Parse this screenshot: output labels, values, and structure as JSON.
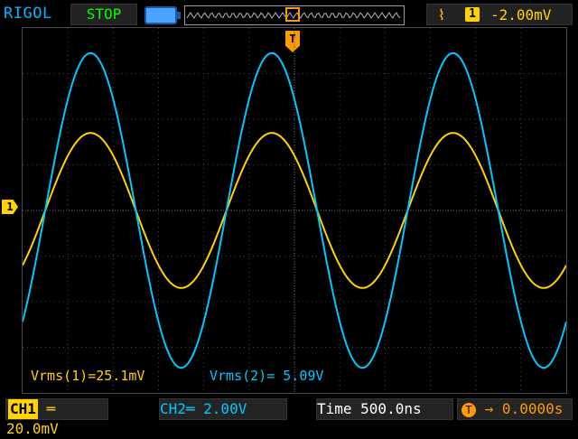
{
  "header": {
    "brand": "RIGOL",
    "run_state": "STOP",
    "trigger_edge_icon": "rising-edge-icon",
    "trigger_channel": "1",
    "trigger_level": "-2.00mV"
  },
  "markers": {
    "trigger_position": "T",
    "channel1": "1"
  },
  "measurements": {
    "ch1": "Vrms(1)=25.1mV",
    "ch2": "Vrms(2)= 5.09V"
  },
  "footer": {
    "ch1_label": "CH1",
    "ch1_scale": "20.0mV",
    "ch2_scale": "CH2═ 2.00V",
    "timebase": "Time 500.0ns",
    "trigger_offset": "0.0000s"
  },
  "colors": {
    "ch1": "#ffd200",
    "ch2": "#00c8ff",
    "accent": "#ff9a00"
  },
  "chart_data": {
    "type": "line",
    "title": "",
    "xlabel": "",
    "ylabel": "",
    "series": [
      {
        "name": "CH1",
        "amplitude_div": 1.7,
        "offset_div": 0,
        "period_div": 4.0,
        "phase_div": 2.5
      },
      {
        "name": "CH2",
        "amplitude_div": 3.45,
        "offset_div": 0,
        "period_div": 4.0,
        "phase_div": 2.5
      }
    ],
    "grid": true
  }
}
